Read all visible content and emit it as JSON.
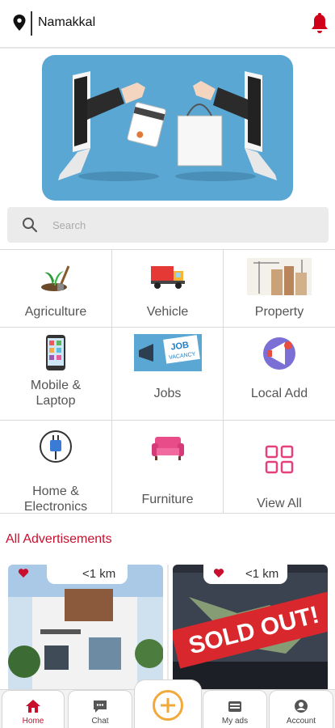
{
  "header": {
    "location": "Namakkal",
    "location_icon": "map-pin-icon",
    "notification_icon": "bell-icon",
    "accent_color": "#d0021b"
  },
  "banner": {
    "image": "online-shopping-illustration",
    "background_color": "#5aa7d3"
  },
  "search": {
    "placeholder": "Search",
    "value": ""
  },
  "categories": [
    {
      "label": "Agriculture",
      "icon": "agriculture-icon"
    },
    {
      "label": "Vehicle",
      "icon": "truck-icon"
    },
    {
      "label": "Property",
      "icon": "buildings-icon"
    },
    {
      "label": "Mobile & Laptop",
      "icon": "mobile-icon"
    },
    {
      "label": "Jobs",
      "icon": "job-vacancy-icon"
    },
    {
      "label": "Local Add",
      "icon": "megaphone-icon"
    },
    {
      "label": "Home & Electronics",
      "icon": "plug-icon"
    },
    {
      "label": "Furniture",
      "icon": "sofa-icon"
    },
    {
      "label": "View All",
      "icon": "grid-icon"
    }
  ],
  "ads_section": {
    "title": "All Advertisements",
    "items": [
      {
        "distance": "<1 km",
        "image": "house-photo"
      },
      {
        "distance": "<1 km",
        "image": "sold-out-photo",
        "overlay_text": "SOLD OUT!"
      }
    ]
  },
  "bottom_nav": {
    "items": [
      {
        "label": "Home",
        "icon": "home-icon",
        "active": true
      },
      {
        "label": "Chat",
        "icon": "chat-icon"
      },
      {
        "label": "",
        "icon": "add-icon"
      },
      {
        "label": "My ads",
        "icon": "ads-icon"
      },
      {
        "label": "Account",
        "icon": "account-icon"
      }
    ]
  }
}
